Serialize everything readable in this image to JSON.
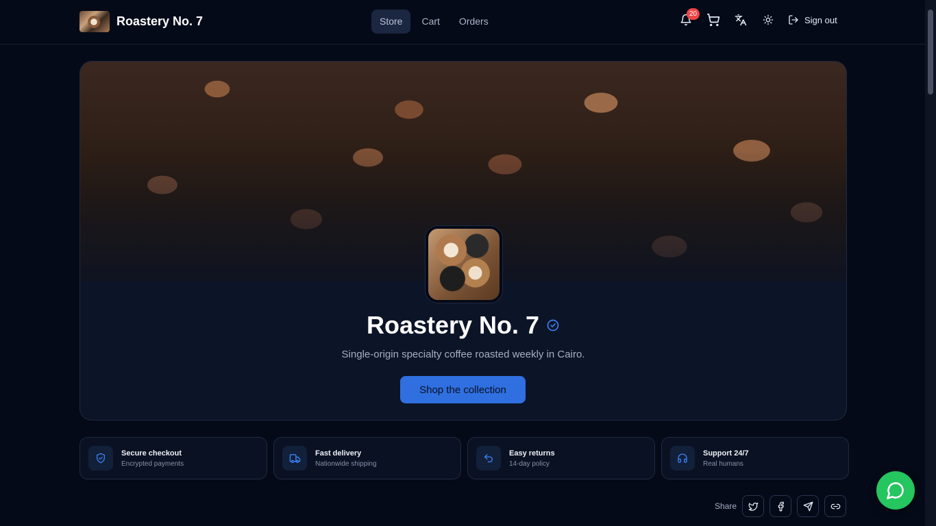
{
  "header": {
    "brand_name": "Roastery No. 7",
    "nav": [
      {
        "label": "Store",
        "active": true
      },
      {
        "label": "Cart",
        "active": false
      },
      {
        "label": "Orders",
        "active": false
      }
    ],
    "notification_count": "20",
    "signout_label": "Sign out",
    "icons": [
      "bell-icon",
      "cart-icon",
      "translate-icon",
      "sun-icon",
      "logout-icon"
    ]
  },
  "hero": {
    "title": "Roastery No. 7",
    "subtitle": "Single-origin specialty coffee roasted weekly in Cairo.",
    "cta_label": "Shop the collection",
    "verified_icon": "verified-badge-icon"
  },
  "features": [
    {
      "title": "Secure checkout",
      "subtitle": "Encrypted payments",
      "icon": "shield-icon"
    },
    {
      "title": "Fast delivery",
      "subtitle": "Nationwide shipping",
      "icon": "truck-icon"
    },
    {
      "title": "Easy returns",
      "subtitle": "14-day policy",
      "icon": "return-arrow-icon"
    },
    {
      "title": "Support 24/7",
      "subtitle": "Real humans",
      "icon": "headphones-icon"
    }
  ],
  "share": {
    "label": "Share",
    "buttons": [
      "twitter-icon",
      "facebook-icon",
      "telegram-icon",
      "link-icon"
    ]
  },
  "colors": {
    "background": "#050a18",
    "accent": "#2f6fe0",
    "badge": "#ef4444",
    "chat_fab": "#25c55f"
  }
}
